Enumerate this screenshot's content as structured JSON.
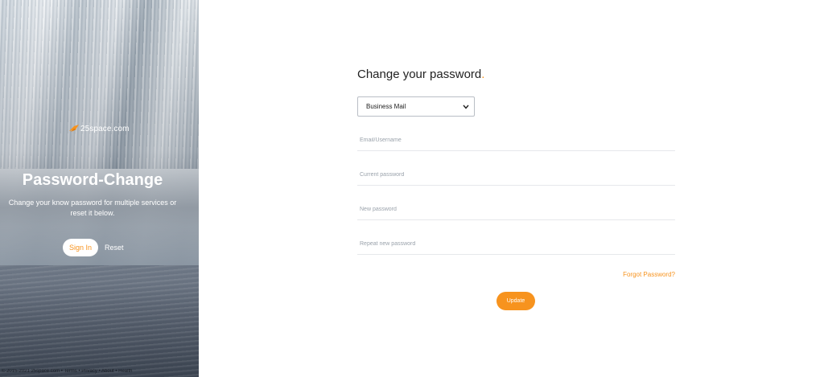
{
  "hero": {
    "logo_text": "25space.com",
    "title": "Password-Change",
    "subtitle": "Change your know password for multiple services or reset it below.",
    "signin_label": "Sign In",
    "reset_label": "Reset",
    "footer": "© 2015-2021 25space.com • Terms • Privacy • About • Health"
  },
  "form": {
    "title": "Change your password",
    "title_dot": ".",
    "service_select": {
      "selected": "Business Mail"
    },
    "fields": {
      "email_placeholder": "Email/Username",
      "current_placeholder": "Current password",
      "new_placeholder": "New password",
      "repeat_placeholder": "Repeat new password"
    },
    "forgot_label": "Forgot Password?",
    "update_label": "Update"
  },
  "colors": {
    "accent": "#f7931e",
    "text": "#222222",
    "placeholder": "#9aa2ab"
  },
  "icons": {
    "logo": "bird-logo-icon",
    "select": "chevron-down-icon"
  }
}
